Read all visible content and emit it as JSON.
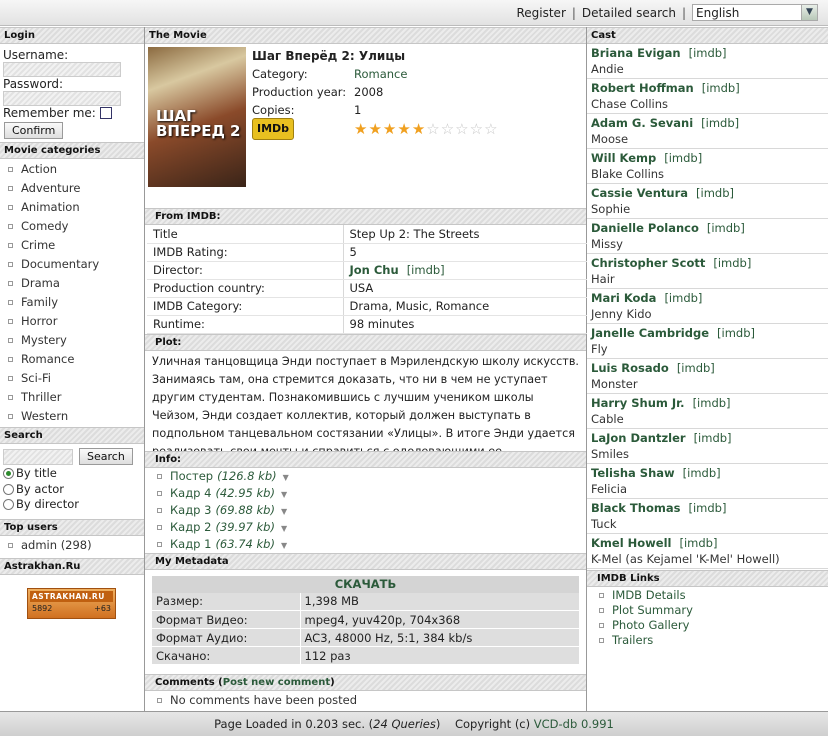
{
  "top": {
    "register": "Register",
    "search": "Detailed search",
    "lang": "English"
  },
  "login": {
    "title": "Login",
    "username": "Username:",
    "password": "Password:",
    "remember": "Remember me:",
    "confirm": "Confirm"
  },
  "categories": {
    "title": "Movie categories",
    "items": [
      "Action",
      "Adventure",
      "Animation",
      "Comedy",
      "Crime",
      "Documentary",
      "Drama",
      "Family",
      "Horror",
      "Mystery",
      "Romance",
      "Sci-Fi",
      "Thriller",
      "Western"
    ]
  },
  "search": {
    "title": "Search",
    "button": "Search",
    "options": [
      "By title",
      "By actor",
      "By director"
    ]
  },
  "topusers": {
    "title": "Top users",
    "items": [
      "admin (298)"
    ]
  },
  "astrakhan": {
    "title": "Astrakhan.Ru",
    "logo": "ASTRAKHAN.RU",
    "c1": "5892",
    "c2": "+63"
  },
  "movie": {
    "header": "The Movie",
    "poster_text": "ШАГ ВПЕРЕД 2",
    "title": "Шаг Вперёд 2: Улицы",
    "category_label": "Category:",
    "category": "Romance",
    "year_label": "Production year:",
    "year": "2008",
    "copies_label": "Copies:",
    "copies": "1",
    "imdb_badge": "IMDb",
    "rating_stars": 5,
    "rating_max": 10
  },
  "imdb": {
    "header": "From IMDB:",
    "rows": [
      [
        "Title",
        "Step Up 2: The Streets"
      ],
      [
        "IMDB Rating:",
        "5"
      ],
      [
        "Director:",
        "Jon Chu"
      ],
      [
        "Production country:",
        "USA"
      ],
      [
        "IMDB Category:",
        "Drama, Music, Romance"
      ],
      [
        "Runtime:",
        "98 minutes"
      ]
    ],
    "imdb_link": "[imdb]"
  },
  "plot": {
    "header": "Plot:",
    "text": "Уличная танцовщица Энди поступает в Мэрилендскую школу искусств. Занимаясь там, она стремится доказать, что ни в чем не уступает другим студентам. Познакомившись с лучшим учеником школы Чейзом, Энди создает коллектив, который должен выступать в подпольном танцевальном состязании «Улицы». В итоге Энди удается реализовать свои мечты и справиться с одолевающими ее проблемами..."
  },
  "info": {
    "header": "Info:",
    "items": [
      [
        "Постер",
        "(126.8 kb)"
      ],
      [
        "Кадр 4",
        "(42.95 kb)"
      ],
      [
        "Кадр 3",
        "(69.88 kb)"
      ],
      [
        "Кадр 2",
        "(39.97 kb)"
      ],
      [
        "Кадр 1",
        "(63.74 kb)"
      ]
    ]
  },
  "metadata": {
    "header": "My Metadata",
    "download": "СКАЧАТЬ",
    "rows": [
      [
        "Размер:",
        "1,398 MB"
      ],
      [
        "Формат Видео:",
        "mpeg4, yuv420p, 704x368"
      ],
      [
        "Формат Аудио:",
        "AC3, 48000 Hz, 5:1, 384 kb/s"
      ],
      [
        "Скачано:",
        "112 раз"
      ]
    ]
  },
  "comments": {
    "header": "Comments",
    "post_link": "Post new comment",
    "none": "No comments have been posted"
  },
  "cast": {
    "header": "Cast",
    "imdb": "[imdb]",
    "items": [
      [
        "Briana Evigan",
        "Andie"
      ],
      [
        "Robert Hoffman",
        "Chase Collins"
      ],
      [
        "Adam G. Sevani",
        "Moose"
      ],
      [
        "Will Kemp",
        "Blake Collins"
      ],
      [
        "Cassie Ventura",
        "Sophie"
      ],
      [
        "Danielle Polanco",
        "Missy"
      ],
      [
        "Christopher Scott",
        "Hair"
      ],
      [
        "Mari Koda",
        "Jenny Kido"
      ],
      [
        "Janelle Cambridge",
        "Fly"
      ],
      [
        "Luis Rosado",
        "Monster"
      ],
      [
        "Harry Shum Jr.",
        "Cable"
      ],
      [
        "LaJon Dantzler",
        "Smiles"
      ],
      [
        "Telisha Shaw",
        "Felicia"
      ],
      [
        "Black Thomas",
        "Tuck"
      ],
      [
        "Kmel Howell",
        "K-Mel (as Kejamel 'K-Mel' Howell)"
      ]
    ]
  },
  "imdblinks": {
    "header": "IMDB Links",
    "items": [
      "IMDB Details",
      "Plot Summary",
      "Photo Gallery",
      "Trailers"
    ]
  },
  "footer": {
    "pre": "Page Loaded in 0.203 sec. (",
    "queries": "24 Queries",
    "post": ")    Copyright (c) ",
    "app": "VCD-db 0.991"
  }
}
